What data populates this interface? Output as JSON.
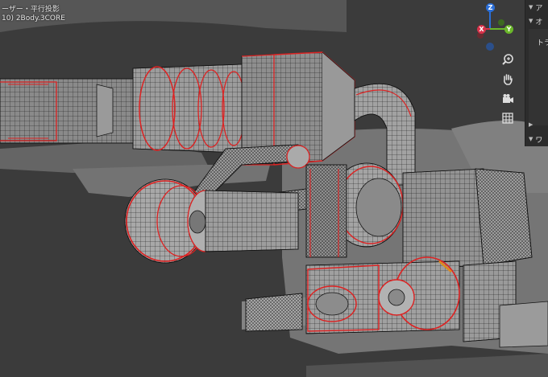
{
  "viewport": {
    "view_name": "ーザー・平行投影",
    "object_name": "10) 2Body.3CORE"
  },
  "gizmo": {
    "axes": [
      {
        "id": "z",
        "label": "Z",
        "color": "#2b6fd8"
      },
      {
        "id": "x",
        "label": "X",
        "color": "#d8324a"
      },
      {
        "id": "y",
        "label": "Y",
        "color": "#6bb82a"
      }
    ]
  },
  "nav_buttons": [
    {
      "id": "zoom",
      "icon": "zoom-icon"
    },
    {
      "id": "pan",
      "icon": "hand-icon"
    },
    {
      "id": "camera",
      "icon": "camera-icon"
    },
    {
      "id": "ortho",
      "icon": "grid-icon"
    }
  ],
  "sidepanel": {
    "headers": [
      {
        "label": "ア",
        "chevron": "▼"
      },
      {
        "label": "オ",
        "chevron": "▼"
      },
      {
        "label": "",
        "chevron": "▶"
      },
      {
        "label": "ワ",
        "chevron": "▼"
      }
    ],
    "body_label": "トラ"
  }
}
